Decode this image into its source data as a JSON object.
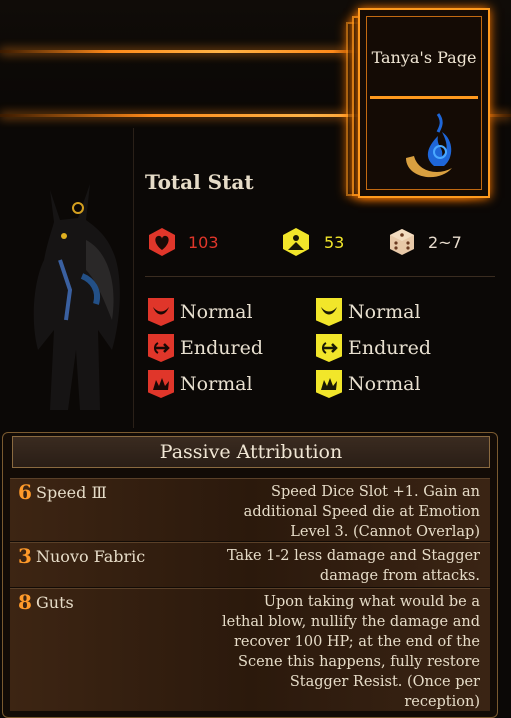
{
  "page_card": {
    "title": "Tanya's Page",
    "icon": "crescent-blue-flame-icon"
  },
  "total_stat": {
    "title": "Total Stat",
    "hp": {
      "value": "103",
      "icon": "heart-health-icon",
      "color": "#e0362a"
    },
    "stagger": {
      "value": "53",
      "icon": "stagger-resist-icon",
      "color": "#f2e62a"
    },
    "speed": {
      "value": "2~7",
      "icon": "speed-dice-icon",
      "color": "#e8c9a8"
    }
  },
  "resistances": {
    "hp": [
      {
        "icon": "slash-icon",
        "label": "Normal"
      },
      {
        "icon": "pierce-icon",
        "label": "Endured"
      },
      {
        "icon": "blunt-icon",
        "label": "Normal"
      }
    ],
    "stagger": [
      {
        "icon": "slash-icon",
        "label": "Normal"
      },
      {
        "icon": "pierce-icon",
        "label": "Endured"
      },
      {
        "icon": "blunt-icon",
        "label": "Normal"
      }
    ]
  },
  "passives": {
    "title": "Passive Attribution",
    "items": [
      {
        "cost": "6",
        "name": "Speed Ⅲ",
        "desc": "Speed Dice Slot +1. Gain an additional Speed die at Emotion Level 3. (Cannot Overlap)"
      },
      {
        "cost": "3",
        "name": "Nuovo Fabric",
        "desc": "Take 1-2 less damage and Stagger damage from attacks."
      },
      {
        "cost": "8",
        "name": "Guts",
        "desc": "Upon taking what would be a lethal blow, nullify the damage and recover 100 HP; at the end of the Scene this happens, fully restore Stagger Resist. (Once per reception)"
      }
    ]
  }
}
